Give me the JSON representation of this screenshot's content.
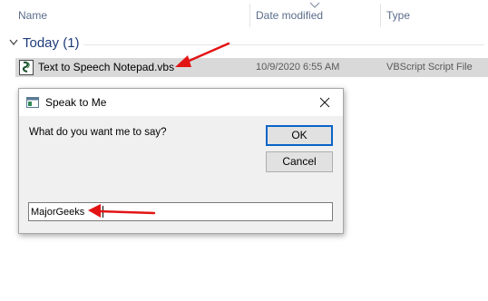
{
  "explorer": {
    "columns": {
      "name": "Name",
      "date_modified": "Date modified",
      "type": "Type"
    },
    "group": {
      "label": "Today (1)"
    },
    "file": {
      "name": "Text to Speech Notepad.vbs",
      "date": "10/9/2020 6:55 AM",
      "type": "VBScript Script File",
      "icon": "vbscript-file-icon",
      "selected": true
    }
  },
  "dialog": {
    "title": "Speak to Me",
    "prompt": "What do you want me to say?",
    "ok_label": "OK",
    "cancel_label": "Cancel",
    "input_value": "MajorGeeks",
    "icons": {
      "app": "app-window-icon",
      "close": "close-icon"
    }
  },
  "annotations": {
    "arrow_color": "#e31414",
    "arrows": [
      "arrow-to-file",
      "arrow-to-input"
    ]
  },
  "colors": {
    "selection": "#d9d9d9",
    "group_header": "#1e3b7a",
    "column_header": "#5a6c8c",
    "default_button_border": "#0a64c8"
  }
}
